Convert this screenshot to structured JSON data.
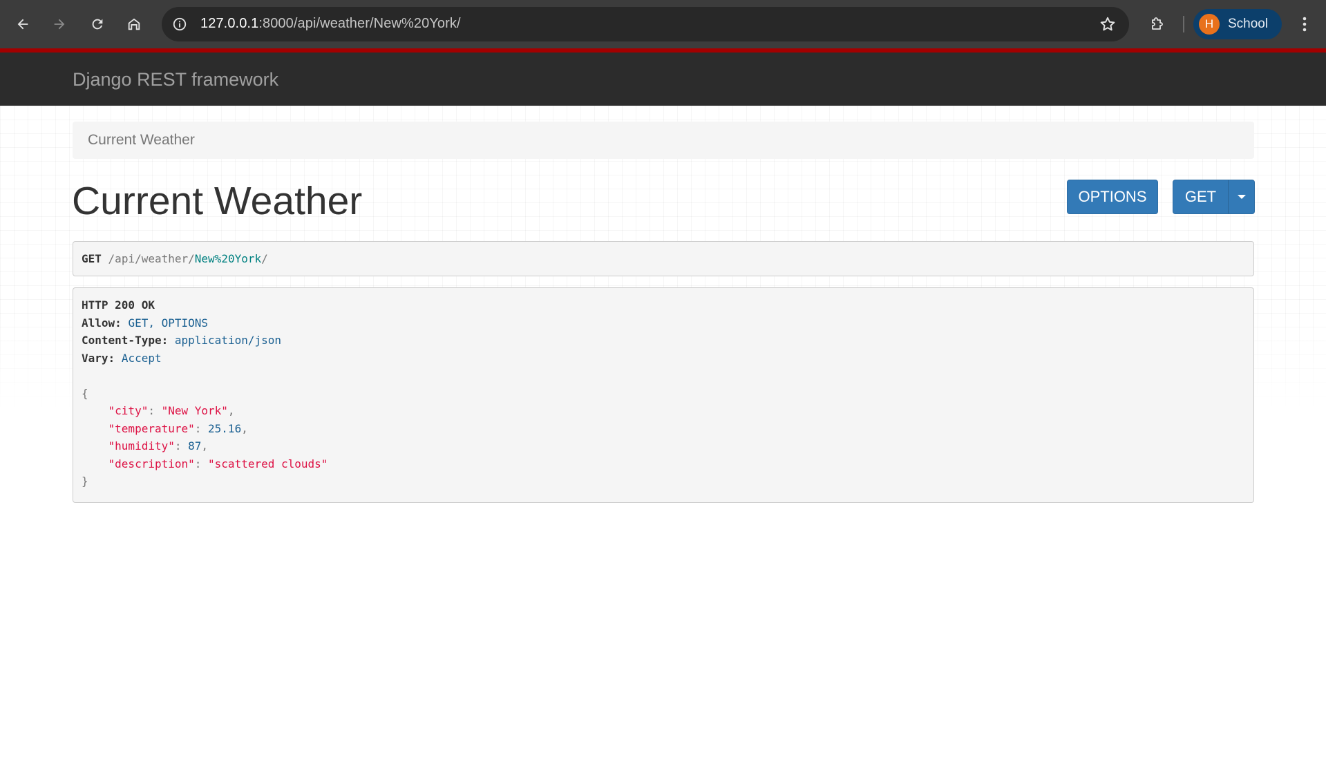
{
  "browser": {
    "url_host": "127.0.0.1",
    "url_rest": ":8000/api/weather/New%20York/",
    "profile_initial": "H",
    "profile_name": "School"
  },
  "navbar": {
    "brand": "Django REST framework"
  },
  "breadcrumb": {
    "current": "Current Weather"
  },
  "page": {
    "title": "Current Weather"
  },
  "actions": {
    "options_label": "OPTIONS",
    "get_label": "GET"
  },
  "request": {
    "method": "GET",
    "path_prefix": "/api/weather/",
    "path_param": "New%20York",
    "path_suffix": "/"
  },
  "response": {
    "status": "HTTP 200 OK",
    "headers": [
      {
        "name": "Allow:",
        "value": "GET, OPTIONS"
      },
      {
        "name": "Content-Type:",
        "value": "application/json"
      },
      {
        "name": "Vary:",
        "value": "Accept"
      }
    ],
    "body": {
      "open": "{",
      "close": "}",
      "fields": [
        {
          "key": "\"city\"",
          "value": "\"New York\"",
          "type": "string",
          "comma": ","
        },
        {
          "key": "\"temperature\"",
          "value": "25.16",
          "type": "number",
          "comma": ","
        },
        {
          "key": "\"humidity\"",
          "value": "87",
          "type": "number",
          "comma": ","
        },
        {
          "key": "\"description\"",
          "value": "\"scattered clouds\"",
          "type": "string",
          "comma": ""
        }
      ]
    }
  },
  "colors": {
    "navbar_bg": "#2c2c2c",
    "navbar_accent": "#a30000",
    "button_primary": "#337ab7",
    "json_string": "#dd1144",
    "json_number": "#195f91"
  }
}
